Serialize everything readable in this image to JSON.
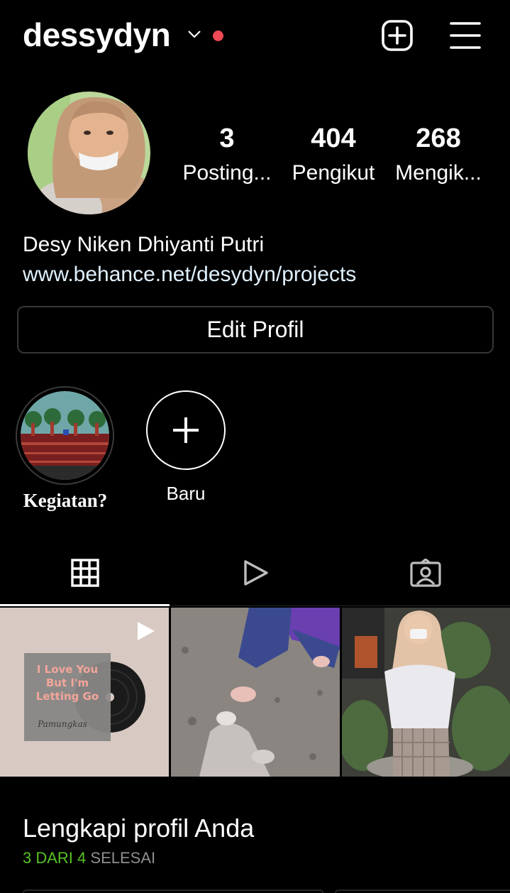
{
  "header": {
    "username": "dessydyn",
    "icons": [
      "chevron-down-icon",
      "notification-dot",
      "add-post-icon",
      "menu-icon"
    ],
    "notification_color": "#ed4956"
  },
  "stats": [
    {
      "value": "3",
      "label": "Posting..."
    },
    {
      "value": "404",
      "label": "Pengikut"
    },
    {
      "value": "268",
      "label": "Mengik..."
    }
  ],
  "bio": {
    "full_name": "Desy Niken Dhiyanti Putri",
    "link": "www.behance.net/desydyn/projects",
    "link_color": "#e0f1ff"
  },
  "edit_profile_label": "Edit Profil",
  "highlights": [
    {
      "label": "Kegiatan?"
    },
    {
      "label": "Baru"
    }
  ],
  "tabs": [
    {
      "icon": "grid-icon",
      "active": true
    },
    {
      "icon": "reels-icon",
      "active": false
    },
    {
      "icon": "tagged-icon",
      "active": false
    }
  ],
  "posts": [
    {
      "type": "reel",
      "cover_lines": [
        "I Love You",
        "But I'm",
        "Letting Go"
      ],
      "cover_signature": "Pamungkas"
    },
    {
      "type": "photo"
    },
    {
      "type": "photo"
    }
  ],
  "complete_profile": {
    "title": "Lengkapi profil Anda",
    "progress_done": "3 DARI 4",
    "progress_rest": "SELESAI",
    "done_color": "#58c322"
  }
}
